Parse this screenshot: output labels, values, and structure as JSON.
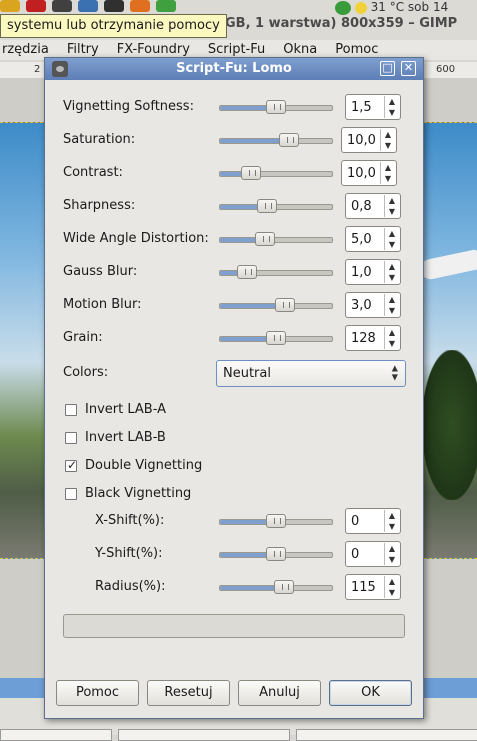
{
  "background": {
    "tooltip": "systemu lub otrzymanie pomocy",
    "window_title": "GB, 1 warstwa) 800x359 – GIMP",
    "tray_text": "31 °C   sob 14",
    "menu": [
      "rzędzia",
      "Filtry",
      "FX-Foundry",
      "Script-Fu",
      "Okna",
      "Pomoc"
    ],
    "ruler_marks": [
      "2",
      "600"
    ]
  },
  "dialog": {
    "title": "Script-Fu: Lomo",
    "maximize_symbol": "□",
    "close_symbol": "✕",
    "sliders": [
      {
        "label": "Vignetting Softness:",
        "value": "1,5",
        "level": 0.5
      },
      {
        "label": "Saturation:",
        "value": "10,0",
        "level": 0.62
      },
      {
        "label": "Contrast:",
        "value": "10,0",
        "level": 0.28
      },
      {
        "label": "Sharpness:",
        "value": "0,8",
        "level": 0.42
      },
      {
        "label": "Wide Angle Distortion:",
        "value": "5,0",
        "level": 0.4
      },
      {
        "label": "Gauss Blur:",
        "value": "1,0",
        "level": 0.24
      },
      {
        "label": "Motion Blur:",
        "value": "3,0",
        "level": 0.58
      },
      {
        "label": "Grain:",
        "value": "128",
        "level": 0.5
      }
    ],
    "colors": {
      "label": "Colors:",
      "value": "Neutral"
    },
    "checkboxes": [
      {
        "label": "Invert LAB-A",
        "checked": false
      },
      {
        "label": "Invert LAB-B",
        "checked": false
      },
      {
        "label": "Double Vignetting",
        "checked": true
      },
      {
        "label": "Black Vignetting",
        "checked": false
      }
    ],
    "shift_sliders": [
      {
        "label": "X-Shift(%):",
        "value": "0",
        "level": 0.5
      },
      {
        "label": "Y-Shift(%):",
        "value": "0",
        "level": 0.5
      },
      {
        "label": "Radius(%):",
        "value": "115",
        "level": 0.57
      }
    ],
    "buttons": {
      "help": "Pomoc",
      "reset": "Resetuj",
      "cancel": "Anuluj",
      "ok": "OK"
    },
    "check_mark": "✓",
    "spin_up": "▲",
    "spin_down": "▼",
    "combo_arrow_up": "▲",
    "combo_arrow_down": "▼"
  }
}
